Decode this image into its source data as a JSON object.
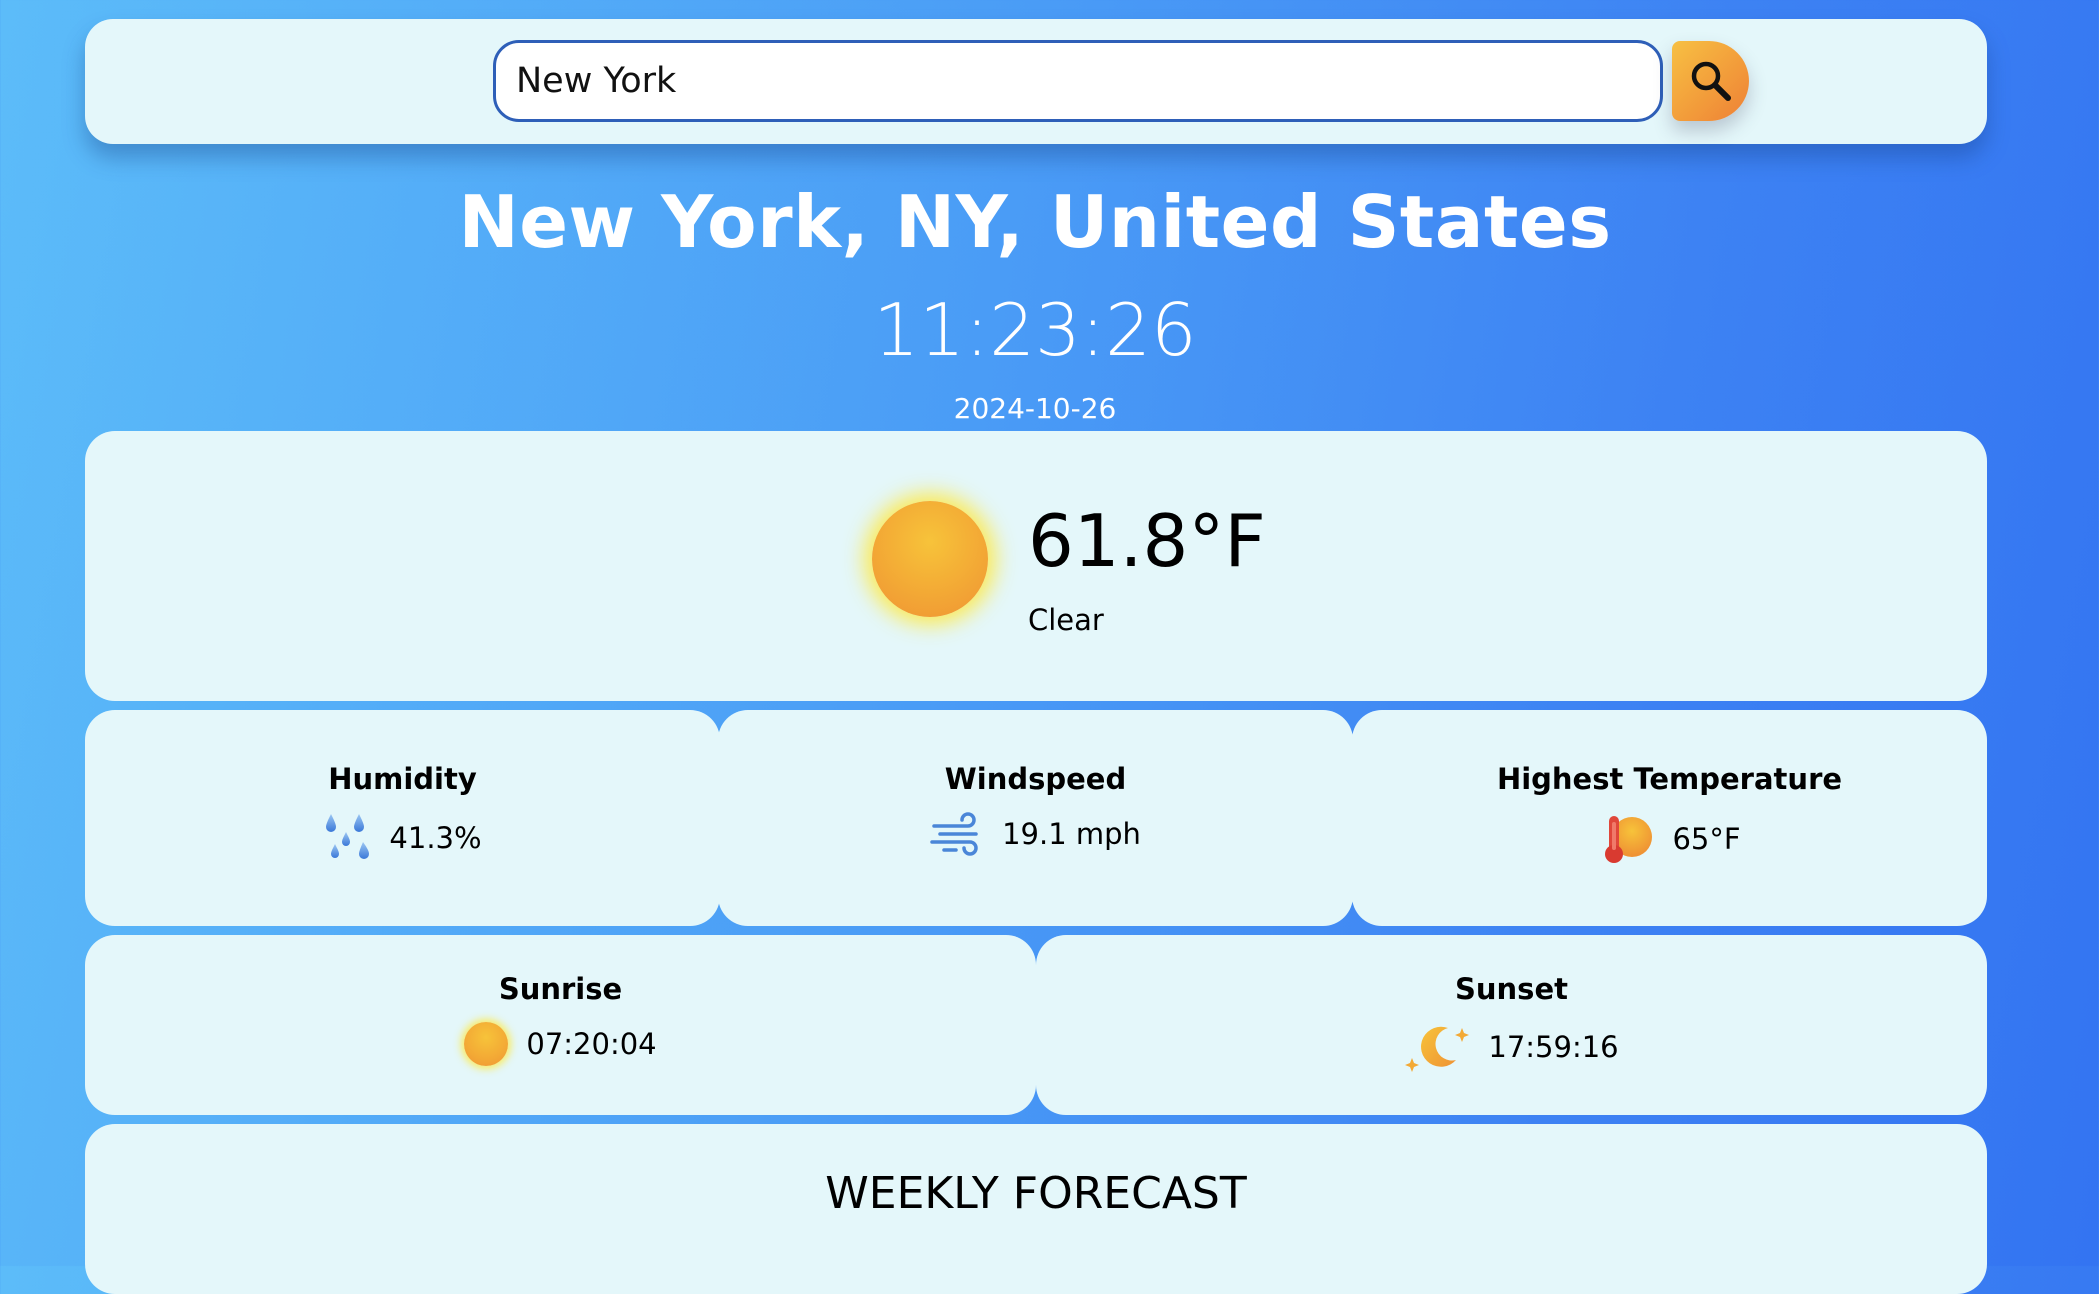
{
  "search": {
    "value": "New York",
    "button_icon": "search-icon"
  },
  "location": {
    "title": "New York, NY, United States",
    "time": "11:23:26",
    "date": "2024-10-26"
  },
  "current": {
    "icon": "sun-icon",
    "temperature": "61.8°F",
    "condition": "Clear"
  },
  "stats": {
    "humidity": {
      "label": "Humidity",
      "value": "41.3%",
      "icon": "raindrops-icon"
    },
    "windspeed": {
      "label": "Windspeed",
      "value": "19.1 mph",
      "icon": "wind-icon"
    },
    "highest_temperature": {
      "label": "Highest Temperature",
      "value": "65°F",
      "icon": "thermometer-sun-icon"
    },
    "sunrise": {
      "label": "Sunrise",
      "value": "07:20:04",
      "icon": "sun-icon"
    },
    "sunset": {
      "label": "Sunset",
      "value": "17:59:16",
      "icon": "moon-stars-icon"
    }
  },
  "forecast": {
    "title": "WEEKLY FORECAST"
  },
  "colors": {
    "card": "#e4f7fa",
    "accent_orange": "#f29a3a",
    "sun_yellow": "#f7c33a",
    "input_border": "#2e5fb8"
  }
}
